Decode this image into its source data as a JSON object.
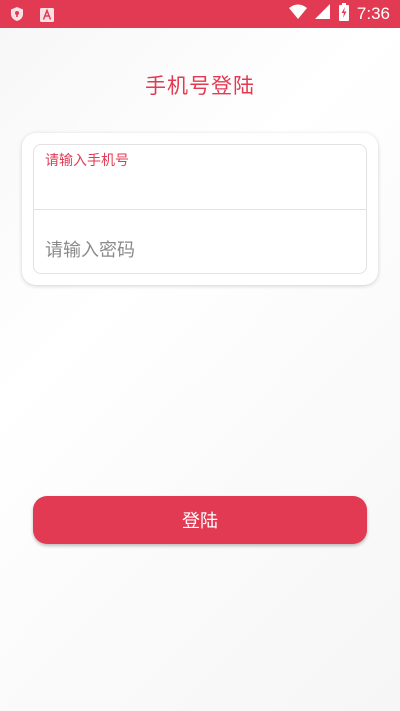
{
  "status_bar": {
    "time": "7:36",
    "icons": [
      "shield-icon",
      "font-a-icon",
      "wifi-icon",
      "cellular-signal-icon",
      "battery-charging-icon"
    ]
  },
  "login": {
    "title": "手机号登陆",
    "phone_placeholder": "请输入手机号",
    "password_placeholder": "请输入密码",
    "submit_label": "登陆"
  },
  "colors": {
    "accent": "#e23a52"
  }
}
